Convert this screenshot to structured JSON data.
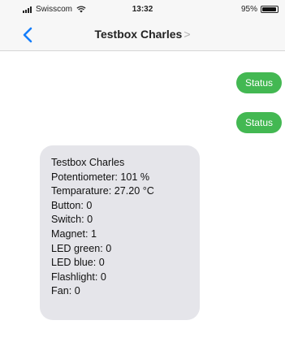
{
  "status_bar": {
    "carrier": "Swisscom",
    "time": "13:32",
    "battery": "95%",
    "battery_level": 0.95,
    "signal_icon": "signal-bars-icon",
    "wifi_icon": "wifi-icon"
  },
  "nav": {
    "back_icon": "chevron-left-icon",
    "title": "Testbox Charles",
    "title_chevron": ">",
    "accent_color": "#157efb"
  },
  "messages": {
    "outgoing": [
      "Status",
      "Status"
    ],
    "outgoing_color": "#43b852",
    "incoming": {
      "lines": [
        "Testbox Charles",
        "Potentiometer: 101 %",
        "Temparature: 27.20 °C",
        "Button: 0",
        "Switch: 0",
        "Magnet: 1",
        "LED green: 0",
        "LED blue: 0",
        "Flashlight: 0",
        "Fan: 0"
      ],
      "color": "#e5e5ea"
    }
  }
}
